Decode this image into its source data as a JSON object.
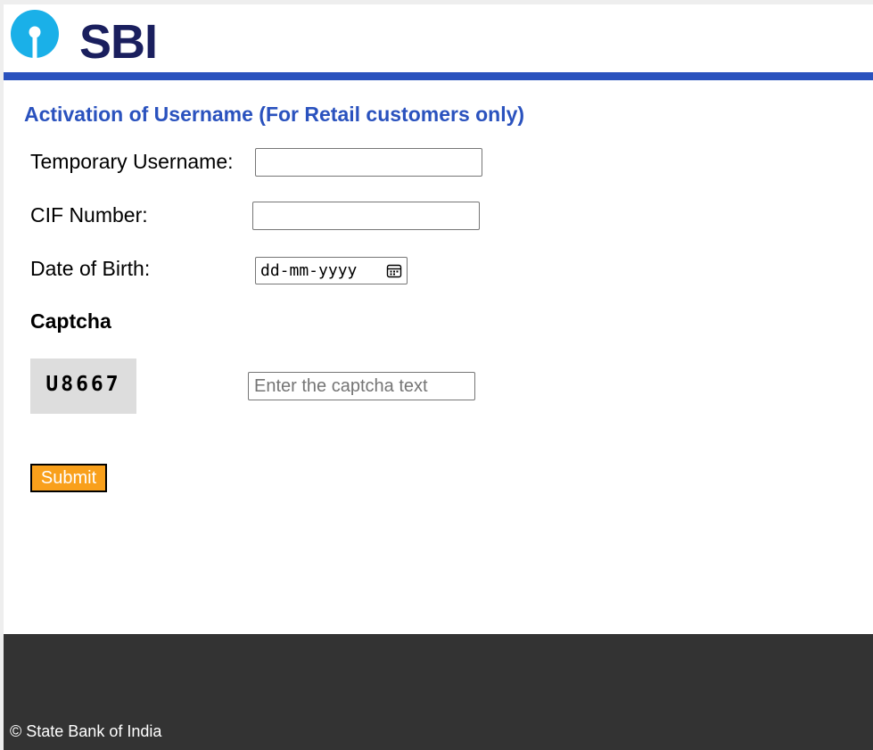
{
  "brand": {
    "name": "SBI",
    "logo_icon": "sbi-keyhole-logo-icon",
    "logo_color": "#1ab0e8",
    "text_color": "#1a1f5e",
    "bar_color": "#2a52be"
  },
  "form": {
    "title": "Activation of Username (For Retail customers only)",
    "temp_username_label": "Temporary Username:",
    "temp_username_value": "",
    "cif_label": "CIF Number:",
    "cif_value": "",
    "dob_label": "Date of Birth:",
    "dob_placeholder": "dd-mm-yyyy",
    "dob_icon": "calendar-icon",
    "captcha_heading": "Captcha",
    "captcha_code": "U8667",
    "captcha_placeholder": "Enter the captcha text",
    "submit_label": "Submit",
    "submit_color": "#f9a01b"
  },
  "footer": {
    "copyright": "© State Bank of India",
    "background": "#333333"
  }
}
